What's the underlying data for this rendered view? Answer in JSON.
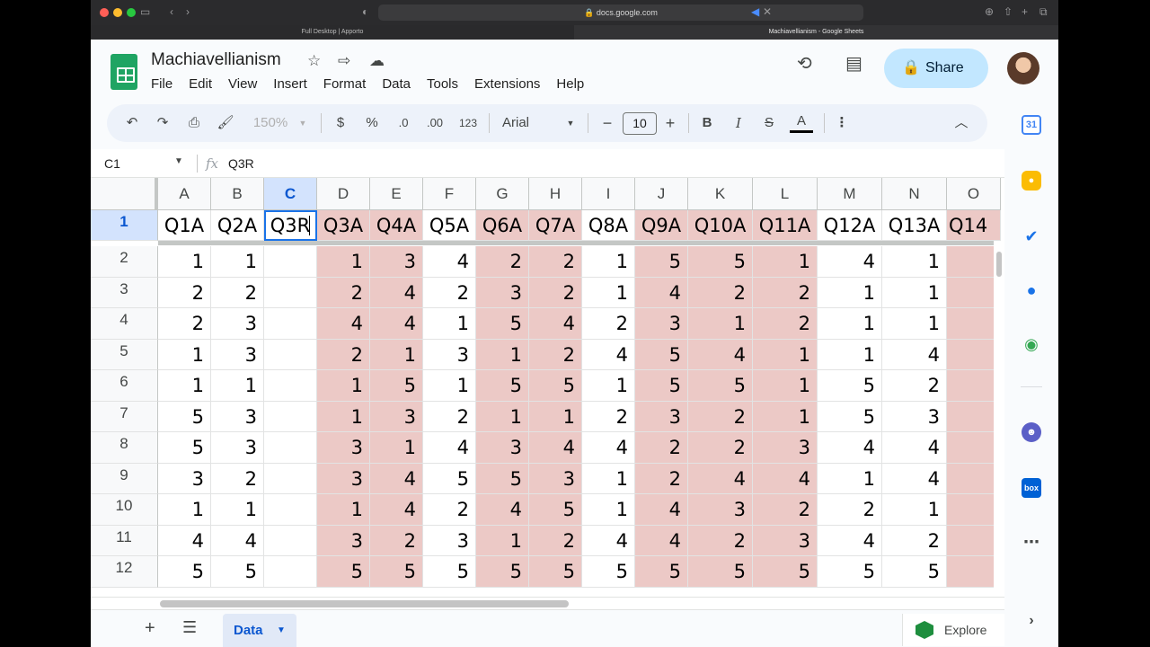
{
  "browser": {
    "url": "docs.google.com",
    "tabs": [
      {
        "label": "Full Desktop | Apporto"
      },
      {
        "label": "Machiavellianism - Google Sheets"
      }
    ]
  },
  "header": {
    "title": "Machiavellianism",
    "menu": [
      "File",
      "Edit",
      "View",
      "Insert",
      "Format",
      "Data",
      "Tools",
      "Extensions",
      "Help"
    ],
    "share_label": "Share"
  },
  "toolbar": {
    "zoom": "150%",
    "currency": "$",
    "percent": "%",
    "dec_decrease": ".0",
    "dec_increase": ".00",
    "number_format": "123",
    "font": "Arial",
    "font_size": "10"
  },
  "formula_bar": {
    "name_box": "C1",
    "fx": "fx",
    "value": "Q3R"
  },
  "grid": {
    "columns": [
      "A",
      "B",
      "C",
      "D",
      "E",
      "F",
      "G",
      "H",
      "I",
      "J",
      "K",
      "L",
      "M",
      "N",
      "O"
    ],
    "header_row": [
      "Q1A",
      "Q2A",
      "Q3R",
      "Q3A",
      "Q4A",
      "Q5A",
      "Q6A",
      "Q7A",
      "Q8A",
      "Q9A",
      "Q10A",
      "Q11A",
      "Q12A",
      "Q13A",
      "Q14"
    ],
    "row_numbers": [
      "1",
      "2",
      "3",
      "4",
      "5",
      "6",
      "7",
      "8",
      "9",
      "10",
      "11",
      "12"
    ],
    "rows": [
      [
        "1",
        "1",
        "",
        "1",
        "3",
        "4",
        "2",
        "2",
        "1",
        "5",
        "5",
        "1",
        "4",
        "1",
        ""
      ],
      [
        "2",
        "2",
        "",
        "2",
        "4",
        "2",
        "3",
        "2",
        "1",
        "4",
        "2",
        "2",
        "1",
        "1",
        ""
      ],
      [
        "2",
        "3",
        "",
        "4",
        "4",
        "1",
        "5",
        "4",
        "2",
        "3",
        "1",
        "2",
        "1",
        "1",
        ""
      ],
      [
        "1",
        "3",
        "",
        "2",
        "1",
        "3",
        "1",
        "2",
        "4",
        "5",
        "4",
        "1",
        "1",
        "4",
        ""
      ],
      [
        "1",
        "1",
        "",
        "1",
        "5",
        "1",
        "5",
        "5",
        "1",
        "5",
        "5",
        "1",
        "5",
        "2",
        ""
      ],
      [
        "5",
        "3",
        "",
        "1",
        "3",
        "2",
        "1",
        "1",
        "2",
        "3",
        "2",
        "1",
        "5",
        "3",
        ""
      ],
      [
        "5",
        "3",
        "",
        "3",
        "1",
        "4",
        "3",
        "4",
        "4",
        "2",
        "2",
        "3",
        "4",
        "4",
        ""
      ],
      [
        "3",
        "2",
        "",
        "3",
        "4",
        "5",
        "5",
        "3",
        "1",
        "2",
        "4",
        "4",
        "1",
        "4",
        ""
      ],
      [
        "1",
        "1",
        "",
        "1",
        "4",
        "2",
        "4",
        "5",
        "1",
        "4",
        "3",
        "2",
        "2",
        "1",
        ""
      ],
      [
        "4",
        "4",
        "",
        "3",
        "2",
        "3",
        "1",
        "2",
        "4",
        "4",
        "2",
        "3",
        "4",
        "2",
        ""
      ],
      [
        "5",
        "5",
        "",
        "5",
        "5",
        "5",
        "5",
        "5",
        "5",
        "5",
        "5",
        "5",
        "5",
        "5",
        ""
      ]
    ],
    "selected_cell": "C1",
    "highlight_color": "#ecc9c6"
  },
  "sheet_tabs": [
    {
      "label": "Data"
    }
  ],
  "explore_label": "Explore",
  "side_panel": [
    "calendar-icon",
    "keep-icon",
    "tasks-icon",
    "contacts-icon",
    "maps-icon",
    "addon-icon",
    "box-icon",
    "more-icon"
  ],
  "side_panel_text": {
    "calendar": "31",
    "box": "box"
  }
}
